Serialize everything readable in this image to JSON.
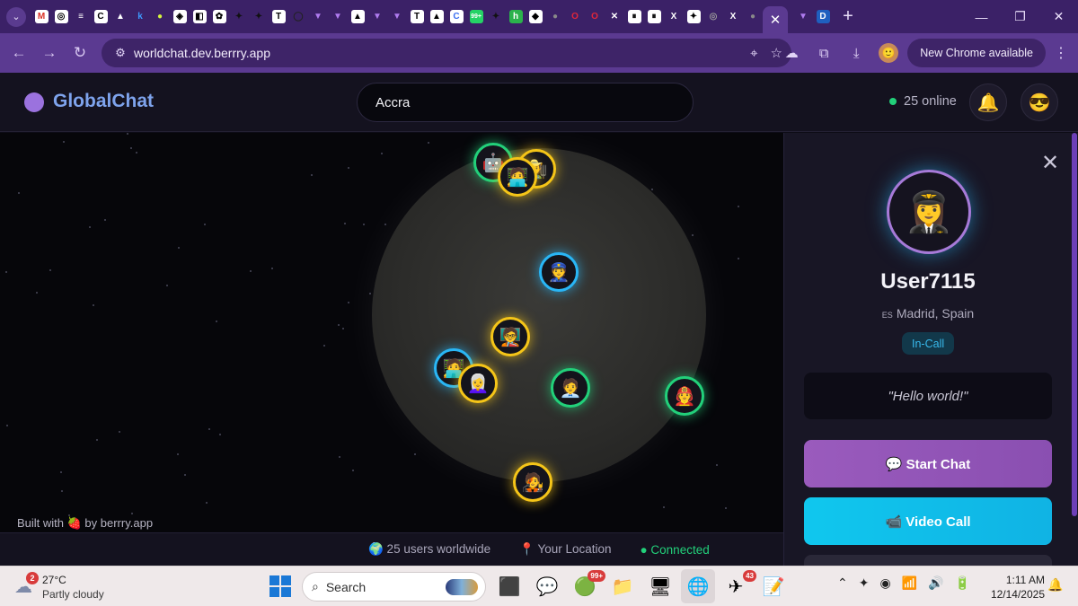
{
  "browser": {
    "url": "worldchat.dev.berrry.app",
    "new_chrome_label": "New Chrome available",
    "tab_favicons": [
      {
        "glyph": "M",
        "bg": "#ffffff",
        "fg": "#d93025"
      },
      {
        "glyph": "◎",
        "bg": "#ffffff",
        "fg": "#000000"
      },
      {
        "glyph": "≡",
        "bg": "transparent",
        "fg": "#ffffff"
      },
      {
        "glyph": "C",
        "bg": "#ffffff",
        "fg": "#000000"
      },
      {
        "glyph": "▲",
        "bg": "transparent",
        "fg": "#ffffff"
      },
      {
        "glyph": "k",
        "bg": "transparent",
        "fg": "#3d9bff"
      },
      {
        "glyph": "●",
        "bg": "transparent",
        "fg": "#d4f33e"
      },
      {
        "glyph": "◈",
        "bg": "#ffffff",
        "fg": "#000000"
      },
      {
        "glyph": "◧",
        "bg": "#ffffff",
        "fg": "#000000"
      },
      {
        "glyph": "✿",
        "bg": "#ffffff",
        "fg": "#000000"
      },
      {
        "glyph": "✦",
        "bg": "transparent",
        "fg": "#111111"
      },
      {
        "glyph": "✦",
        "bg": "transparent",
        "fg": "#111111"
      },
      {
        "glyph": "T",
        "bg": "#ffffff",
        "fg": "#000000"
      },
      {
        "glyph": "◯",
        "bg": "transparent",
        "fg": "#222222"
      },
      {
        "glyph": "▼",
        "bg": "transparent",
        "fg": "#b07cf0"
      },
      {
        "glyph": "▼",
        "bg": "transparent",
        "fg": "#b07cf0"
      },
      {
        "glyph": "▲",
        "bg": "#ffffff",
        "fg": "#000000"
      },
      {
        "glyph": "▼",
        "bg": "transparent",
        "fg": "#b07cf0"
      },
      {
        "glyph": "▼",
        "bg": "transparent",
        "fg": "#b07cf0"
      },
      {
        "glyph": "T",
        "bg": "#ffffff",
        "fg": "#000000"
      },
      {
        "glyph": "▲",
        "bg": "#ffffff",
        "fg": "#000000"
      },
      {
        "glyph": "C",
        "bg": "#ffffff",
        "fg": "#3a6df0"
      },
      {
        "glyph": "99+",
        "bg": "#25d366",
        "fg": "#ffffff"
      },
      {
        "glyph": "✦",
        "bg": "transparent",
        "fg": "#111111"
      },
      {
        "glyph": "h",
        "bg": "#2bb24c",
        "fg": "#ffffff"
      },
      {
        "glyph": "◆",
        "bg": "#ffffff",
        "fg": "#000000"
      },
      {
        "glyph": "●",
        "bg": "transparent",
        "fg": "#888888"
      },
      {
        "glyph": "O",
        "bg": "transparent",
        "fg": "#e0263a"
      },
      {
        "glyph": "O",
        "bg": "transparent",
        "fg": "#e0263a"
      },
      {
        "glyph": "✕",
        "bg": "transparent",
        "fg": "#ffffff"
      },
      {
        "glyph": "⏸",
        "bg": "#ffffff",
        "fg": "#000000"
      },
      {
        "glyph": "⏸",
        "bg": "#ffffff",
        "fg": "#000000"
      },
      {
        "glyph": "X",
        "bg": "transparent",
        "fg": "#ffffff"
      },
      {
        "glyph": "✦",
        "bg": "#ffffff",
        "fg": "#000000"
      },
      {
        "glyph": "◎",
        "bg": "transparent",
        "fg": "#999999"
      },
      {
        "glyph": "X",
        "bg": "transparent",
        "fg": "#ffffff"
      },
      {
        "glyph": "●",
        "bg": "transparent",
        "fg": "#888888"
      }
    ],
    "after_active_tabs": [
      {
        "glyph": "▼",
        "bg": "transparent",
        "fg": "#b07cf0"
      },
      {
        "glyph": "D",
        "bg": "#1f5fbf",
        "fg": "#ffffff"
      }
    ]
  },
  "app": {
    "logo": "GlobalChat",
    "search_value": "Accra",
    "online_text": "25 online",
    "notifications_icon": "🔔",
    "profile_icon": "😎",
    "built_with": "Built with 🍓 by berrry.app",
    "footer": {
      "users": "🌍 25 users worldwide",
      "location": "📍 Your Location",
      "connected": "● Connected"
    }
  },
  "markers": [
    {
      "emoji": "🤖",
      "ring": "green"
    },
    {
      "emoji": "🧑‍🌾",
      "ring": "yellow"
    },
    {
      "emoji": "🧑‍💻",
      "ring": "yellow"
    },
    {
      "emoji": "👮",
      "ring": "blue"
    },
    {
      "emoji": "🧑‍🏫",
      "ring": "yellow"
    },
    {
      "emoji": "🧑‍💻",
      "ring": "blue"
    },
    {
      "emoji": "👩‍🦳",
      "ring": "yellow"
    },
    {
      "emoji": "🧑‍💼",
      "ring": "green"
    },
    {
      "emoji": "🧑‍🚒",
      "ring": "green"
    },
    {
      "emoji": "🧑‍🎤",
      "ring": "yellow"
    }
  ],
  "profile": {
    "avatar": "👩‍✈️",
    "username": "User7115",
    "country_code": "ES",
    "location": "Madrid, Spain",
    "status": "In-Call",
    "quote": "\"Hello world!\"",
    "start_chat": "💬 Start Chat",
    "video_call": "📹 Video Call",
    "third_button": ""
  },
  "taskbar": {
    "weather_badge": "2",
    "temperature": "27°C",
    "condition": "Partly cloudy",
    "search_placeholder": "Search",
    "time": "1:11 AM",
    "date": "12/14/2025",
    "apps": [
      {
        "name": "files-app",
        "glyph": "⬛"
      },
      {
        "name": "meet-app",
        "glyph": "💬"
      },
      {
        "name": "whatsapp-app",
        "glyph": "🟢",
        "badge": "99+"
      },
      {
        "name": "explorer-app",
        "glyph": "📁"
      },
      {
        "name": "monitor-app",
        "glyph": "🖥"
      },
      {
        "name": "chrome-app",
        "glyph": "🌐",
        "active": true
      },
      {
        "name": "telegram-app",
        "glyph": "✈",
        "badge": "43"
      },
      {
        "name": "editor-app",
        "glyph": "📝"
      }
    ],
    "tray_icons": [
      "⌃",
      "✦",
      "◉",
      "📶",
      "🔊",
      "🔋"
    ]
  }
}
